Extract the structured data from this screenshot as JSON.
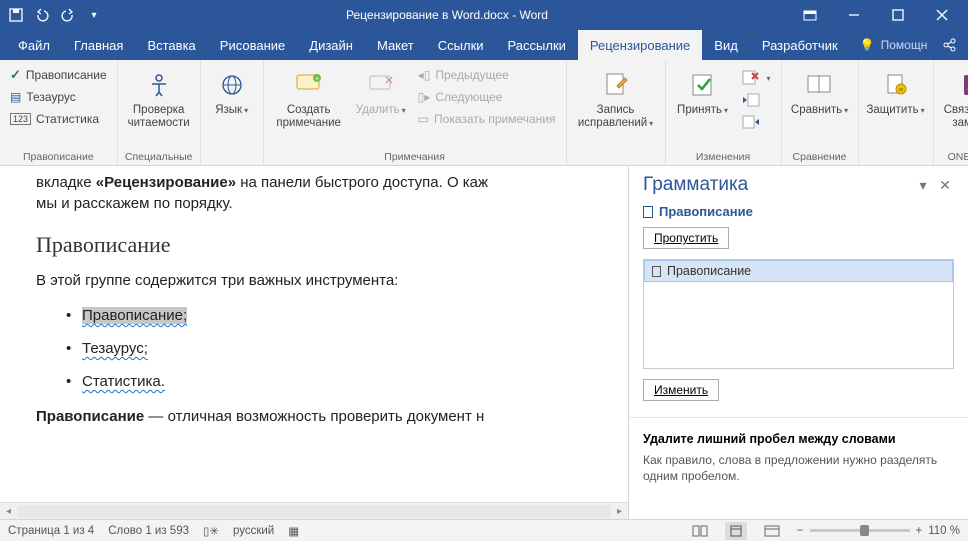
{
  "title": "Рецензирование в Word.docx - Word",
  "tabs": [
    "Файл",
    "Главная",
    "Вставка",
    "Рисование",
    "Дизайн",
    "Макет",
    "Ссылки",
    "Рассылки",
    "Рецензирование",
    "Вид",
    "Разработчик"
  ],
  "active_tab": 8,
  "help_placeholder": "Помощн",
  "ribbon": {
    "g1": {
      "label": "Правописание",
      "items": [
        "Правописание",
        "Тезаурус",
        "Статистика"
      ]
    },
    "g2": {
      "label": "Специальные",
      "big": "Проверка\nчитаемости"
    },
    "g3": {
      "label": "",
      "big": "Язык"
    },
    "g4": {
      "label": "Примечания",
      "create": "Создать\nпримечание",
      "delete": "Удалить",
      "prev": "Предыдущее",
      "next": "Следующее",
      "show": "Показать примечания"
    },
    "g5": {
      "label": "",
      "big": "Запись\nисправлений"
    },
    "g6": {
      "label": "Изменения",
      "accept": "Принять"
    },
    "g7": {
      "label": "Сравнение",
      "big": "Сравнить"
    },
    "g8": {
      "label": "",
      "big": "Защитить"
    },
    "g9": {
      "label": "ONENOTE",
      "big": "Связанные\nзаметки"
    }
  },
  "doc": {
    "line1a": "вкладке ",
    "line1b": "«Рецензирование»",
    "line1c": " на панели быстрого доступа. О каж",
    "line2": "мы и расскажем по порядку.",
    "h2": "Правописание",
    "p2": "В этой группе содержится три важных инструмента:",
    "li1": "Правописание;",
    "li2": "Тезаурус;",
    "li3": "Статистика.",
    "p3a": "Правописание",
    "p3b": " — отличная возможность проверить документ н"
  },
  "pane": {
    "title": "Грамматика",
    "sub": "Правописание",
    "skip": "Пропустить",
    "suggestion": "Правописание",
    "change": "Изменить",
    "rule_title": "Удалите лишний пробел между словами",
    "rule_desc": "Как правило, слова в предложении нужно разделять одним пробелом."
  },
  "status": {
    "page": "Страница 1 из 4",
    "words": "Слово 1 из 593",
    "lang": "русский",
    "zoom": "110 %"
  }
}
